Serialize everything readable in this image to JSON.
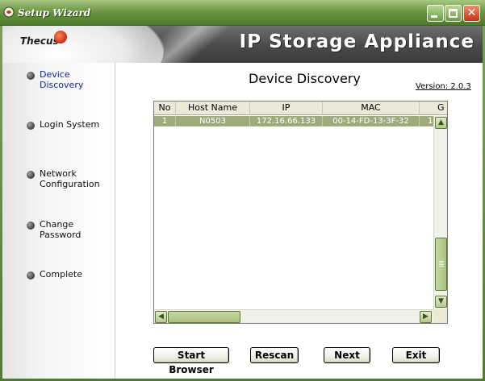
{
  "window": {
    "title": "Setup Wizard",
    "minimize_glyph": "",
    "maximize_glyph": "",
    "close_glyph": "✕"
  },
  "banner": {
    "logo_text": "Thecus",
    "product_title": "IP Storage Appliance"
  },
  "nav": {
    "items": [
      {
        "label": "Device Discovery",
        "active": true
      },
      {
        "label": "Login System",
        "active": false
      },
      {
        "label": "Network\nConfiguration",
        "active": false
      },
      {
        "label": "Change Password",
        "active": false
      },
      {
        "label": "Complete",
        "active": false
      }
    ]
  },
  "main": {
    "title": "Device Discovery",
    "version": "Version: 2.0.3"
  },
  "table": {
    "columns": [
      "No",
      "Host Name",
      "IP",
      "MAC",
      "G"
    ],
    "rows": [
      [
        "1",
        "N0503",
        "172.16.66.133",
        "00-14-FD-13-3F-32",
        "1"
      ]
    ]
  },
  "scroll": {
    "up": "▲",
    "down": "▼",
    "left": "◀",
    "right": "▶"
  },
  "buttons": {
    "start_browser": "Start Browser",
    "rescan": "Rescan",
    "next": "Next",
    "exit": "Exit"
  },
  "colors": {
    "selected_row": "#9eab7d",
    "titlebar": "#6c9644",
    "active_nav": "#0c1fae"
  }
}
